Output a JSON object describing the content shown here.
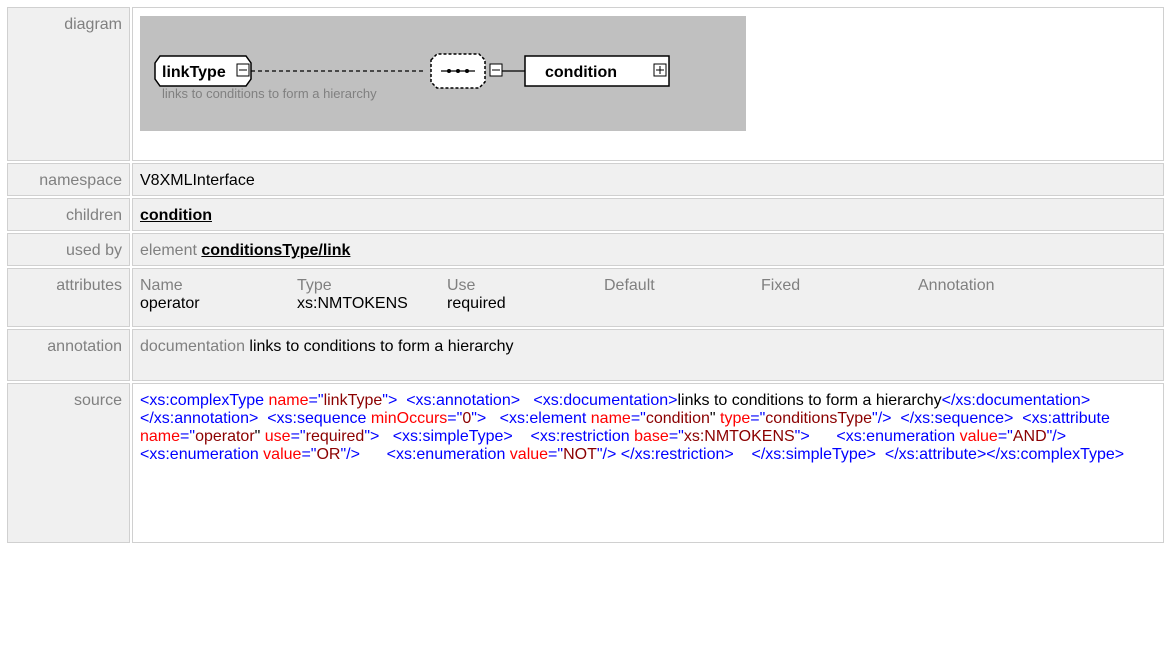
{
  "labels": {
    "diagram": "diagram",
    "namespace": "namespace",
    "children": "children",
    "used_by": "used by",
    "attributes": "attributes",
    "annotation": "annotation",
    "source": "source"
  },
  "diagram": {
    "type_name": "linkType",
    "child_name": "condition",
    "documentation": "links to conditions to form a hierarchy",
    "expand_glyph": "+",
    "collapse_glyph": "−",
    "sequence_glyph": "•••",
    "sequence_icon": "sequence-compositor-icon"
  },
  "namespace": "V8XMLInterface",
  "children": "condition",
  "used_by": {
    "kind": "element",
    "link": "conditionsType/link"
  },
  "attributes": {
    "headers": [
      "Name",
      "Type",
      "Use",
      "Default",
      "Fixed",
      "Annotation"
    ],
    "rows": [
      [
        "operator",
        "xs:NMTOKENS",
        "required",
        "",
        "",
        ""
      ]
    ]
  },
  "annotation": {
    "label": "documentation",
    "text": "links to conditions to form a hierarchy"
  },
  "source": {
    "t01": "<xs:complexType",
    "t02": " name",
    "t03": "=\"",
    "t04": "linkType",
    "t05": "\">",
    "t06": "<xs:annotation>",
    "t07": "<xs:documentation>",
    "t08": "links to conditions to form a hierarchy",
    "t09": "</xs:documentation>",
    "t10": "</xs:annotation>",
    "t11": "<xs:sequence",
    "t12": " minOccurs",
    "t13": "0",
    "t14": "<xs:element",
    "t15": "name",
    "t16": "condition",
    "t17": " type",
    "t18": "conditionsType",
    "t19": "\"/>",
    "t20": "</xs:sequence>",
    "t21": "<xs:attribute",
    "t22": "operator",
    "t23": "use",
    "t24": "required",
    "t25": "<xs:simpleType>",
    "t26": "<xs:restriction",
    "t27": " base",
    "t28": "xs:NMTOKENS",
    "t29": "<xs:enumeration",
    "t30": "value",
    "t31": "AND",
    "t32": " value",
    "t33": "OR",
    "t34": "NOT",
    "t35": "</xs:restriction>",
    "t36": "</xs:simpleType>",
    "t37": "</xs:attribute>",
    "t38": "</xs:complexType>"
  }
}
